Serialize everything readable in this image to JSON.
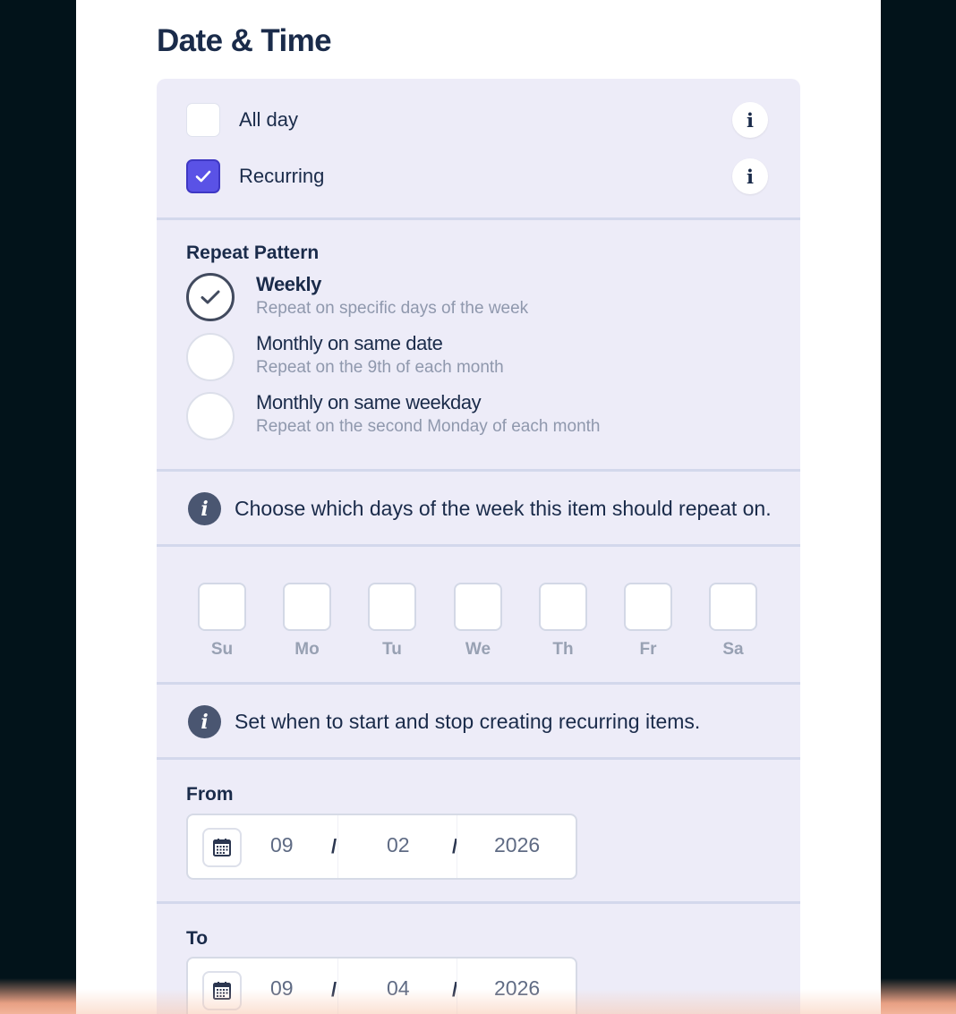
{
  "form": {
    "title": "Date & Time",
    "all_day": {
      "label": "All day",
      "checked": false
    },
    "recurring": {
      "label": "Recurring",
      "checked": true
    },
    "info_glyph": "i"
  },
  "repeat_pattern": {
    "title": "Repeat Pattern",
    "options": [
      {
        "title": "Weekly",
        "description": "Repeat on specific days of the week",
        "selected": true
      },
      {
        "title": "Monthly on same date",
        "description": "Repeat on the 9th of each month",
        "selected": false
      },
      {
        "title": "Monthly on same weekday",
        "description": "Repeat on the second Monday of each month",
        "selected": false
      }
    ]
  },
  "days_info": "Choose which days of the week this item should repeat on.",
  "days": [
    {
      "label": "Su",
      "checked": false
    },
    {
      "label": "Mo",
      "checked": false
    },
    {
      "label": "Tu",
      "checked": false
    },
    {
      "label": "We",
      "checked": false
    },
    {
      "label": "Th",
      "checked": false
    },
    {
      "label": "Fr",
      "checked": false
    },
    {
      "label": "Sa",
      "checked": false
    }
  ],
  "range_info": "Set when to start and stop creating recurring items.",
  "from": {
    "label": "From",
    "month": "09",
    "day": "02",
    "year": "2026",
    "separator": "/"
  },
  "to": {
    "label": "To",
    "month": "09",
    "day": "04",
    "year": "2026",
    "separator": "/"
  },
  "colors": {
    "accent": "#5a52e6",
    "panel": "#edecf8",
    "text": "#1a2b4a",
    "muted": "#8f98ad"
  },
  "icons": [
    "check-icon",
    "info-icon",
    "calendar-icon",
    "check-circle-icon"
  ]
}
